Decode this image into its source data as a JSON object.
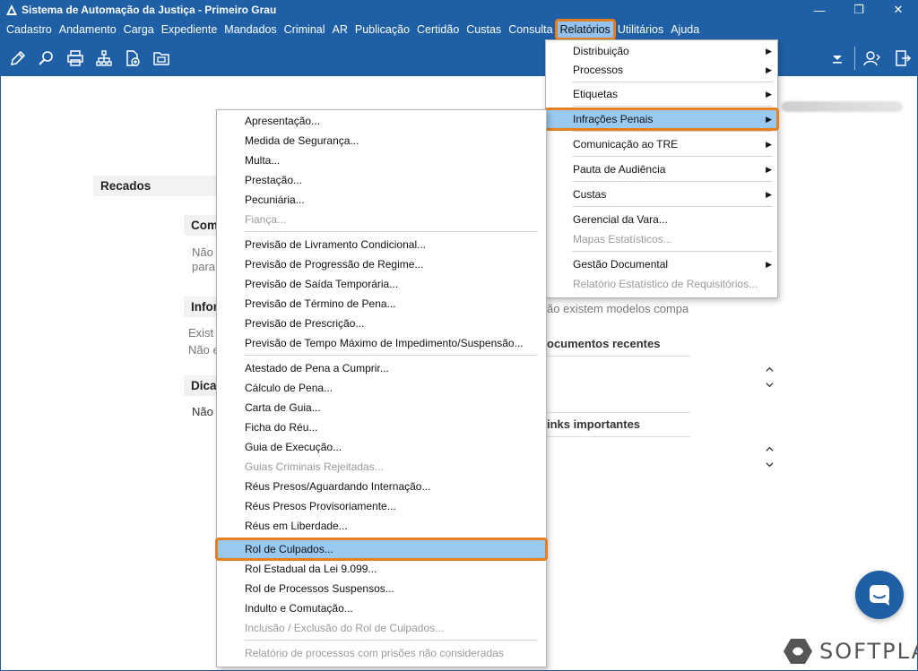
{
  "window": {
    "title": "Sistema de Automação da Justiça - Primeiro Grau",
    "minimize": "—",
    "restore": "❐",
    "close": "✕"
  },
  "menubar": [
    {
      "label": "Cadastro"
    },
    {
      "label": "Andamento"
    },
    {
      "label": "Carga"
    },
    {
      "label": "Expediente"
    },
    {
      "label": "Mandados"
    },
    {
      "label": "Criminal"
    },
    {
      "label": "AR"
    },
    {
      "label": "Publicação"
    },
    {
      "label": "Certidão"
    },
    {
      "label": "Custas"
    },
    {
      "label": "Consulta"
    },
    {
      "label": "Relatórios"
    },
    {
      "label": "Utilitários"
    },
    {
      "label": "Ajuda"
    }
  ],
  "toolbar_icons": [
    "edit-icon",
    "search-document-icon",
    "print-icon",
    "hierarchy-icon",
    "add-file-icon",
    "folder-icon"
  ],
  "background": {
    "recados": "Recados",
    "com": "Com",
    "nao1": "Não",
    "para": "para",
    "infor": "Infor",
    "exist": "Exist",
    "nao_e": "Não e",
    "dica": "Dica",
    "nao2": "Não",
    "modelos_text": "ão existem modelos compa",
    "documentos_recentes": "ocumentos recentes",
    "links_importantes": "inks importantes"
  },
  "relatorios_menu": [
    {
      "label": "Distribuição",
      "submenu": true
    },
    {
      "label": "Processos",
      "submenu": true
    },
    {
      "label": "Etiquetas",
      "submenu": true
    },
    {
      "label": "Infrações Penais",
      "submenu": true,
      "highlighted": true
    },
    {
      "label": "Comunicação ao TRE",
      "submenu": true
    },
    {
      "label": "Pauta de Audiência",
      "submenu": true
    },
    {
      "label": "Custas",
      "submenu": true
    },
    {
      "label": "Gerencial da Vara..."
    },
    {
      "label": "Mapas Estatísticos...",
      "disabled": true
    },
    {
      "label": "Gestão Documental",
      "submenu": true
    },
    {
      "label": "Relatório Estatístico de Requisitórios...",
      "disabled": true
    }
  ],
  "infracoes_menu": [
    {
      "label": "Apresentação..."
    },
    {
      "label": "Medida de Segurança..."
    },
    {
      "label": "Multa..."
    },
    {
      "label": "Prestação..."
    },
    {
      "label": "Pecuniária..."
    },
    {
      "label": "Fiança...",
      "disabled": true
    },
    {
      "label": "Previsão de Livramento Condicional..."
    },
    {
      "label": "Previsão de Progressão de Regime..."
    },
    {
      "label": "Previsão de Saída Temporária..."
    },
    {
      "label": "Previsão de Término de Pena..."
    },
    {
      "label": "Previsão de Prescrição..."
    },
    {
      "label": "Previsão de Tempo Máximo de Impedimento/Suspensão..."
    },
    {
      "label": "Atestado de Pena a Cumprir..."
    },
    {
      "label": "Cálculo de Pena..."
    },
    {
      "label": "Carta de Guia..."
    },
    {
      "label": "Ficha do Réu..."
    },
    {
      "label": "Guia de Execução..."
    },
    {
      "label": "Guias Criminais Rejeitadas...",
      "disabled": true
    },
    {
      "label": "Réus Presos/Aguardando Internação..."
    },
    {
      "label": "Réus Presos Provisoriamente..."
    },
    {
      "label": "Réus em Liberdade..."
    },
    {
      "label": "Rol de Culpados...",
      "highlighted": true
    },
    {
      "label": "Rol Estadual da Lei 9.099..."
    },
    {
      "label": "Rol de Processos Suspensos..."
    },
    {
      "label": "Indulto e Comutação..."
    },
    {
      "label": "Inclusão / Exclusão do Rol de Culpados...",
      "disabled": true
    },
    {
      "label": "Relatório de processos com prisões não consideradas",
      "disabled": true
    }
  ],
  "brand": {
    "name": "SOFTPLAN"
  },
  "colors": {
    "accent": "#1f5fa6",
    "highlight": "#99c9f0",
    "callout": "#e67e22"
  }
}
